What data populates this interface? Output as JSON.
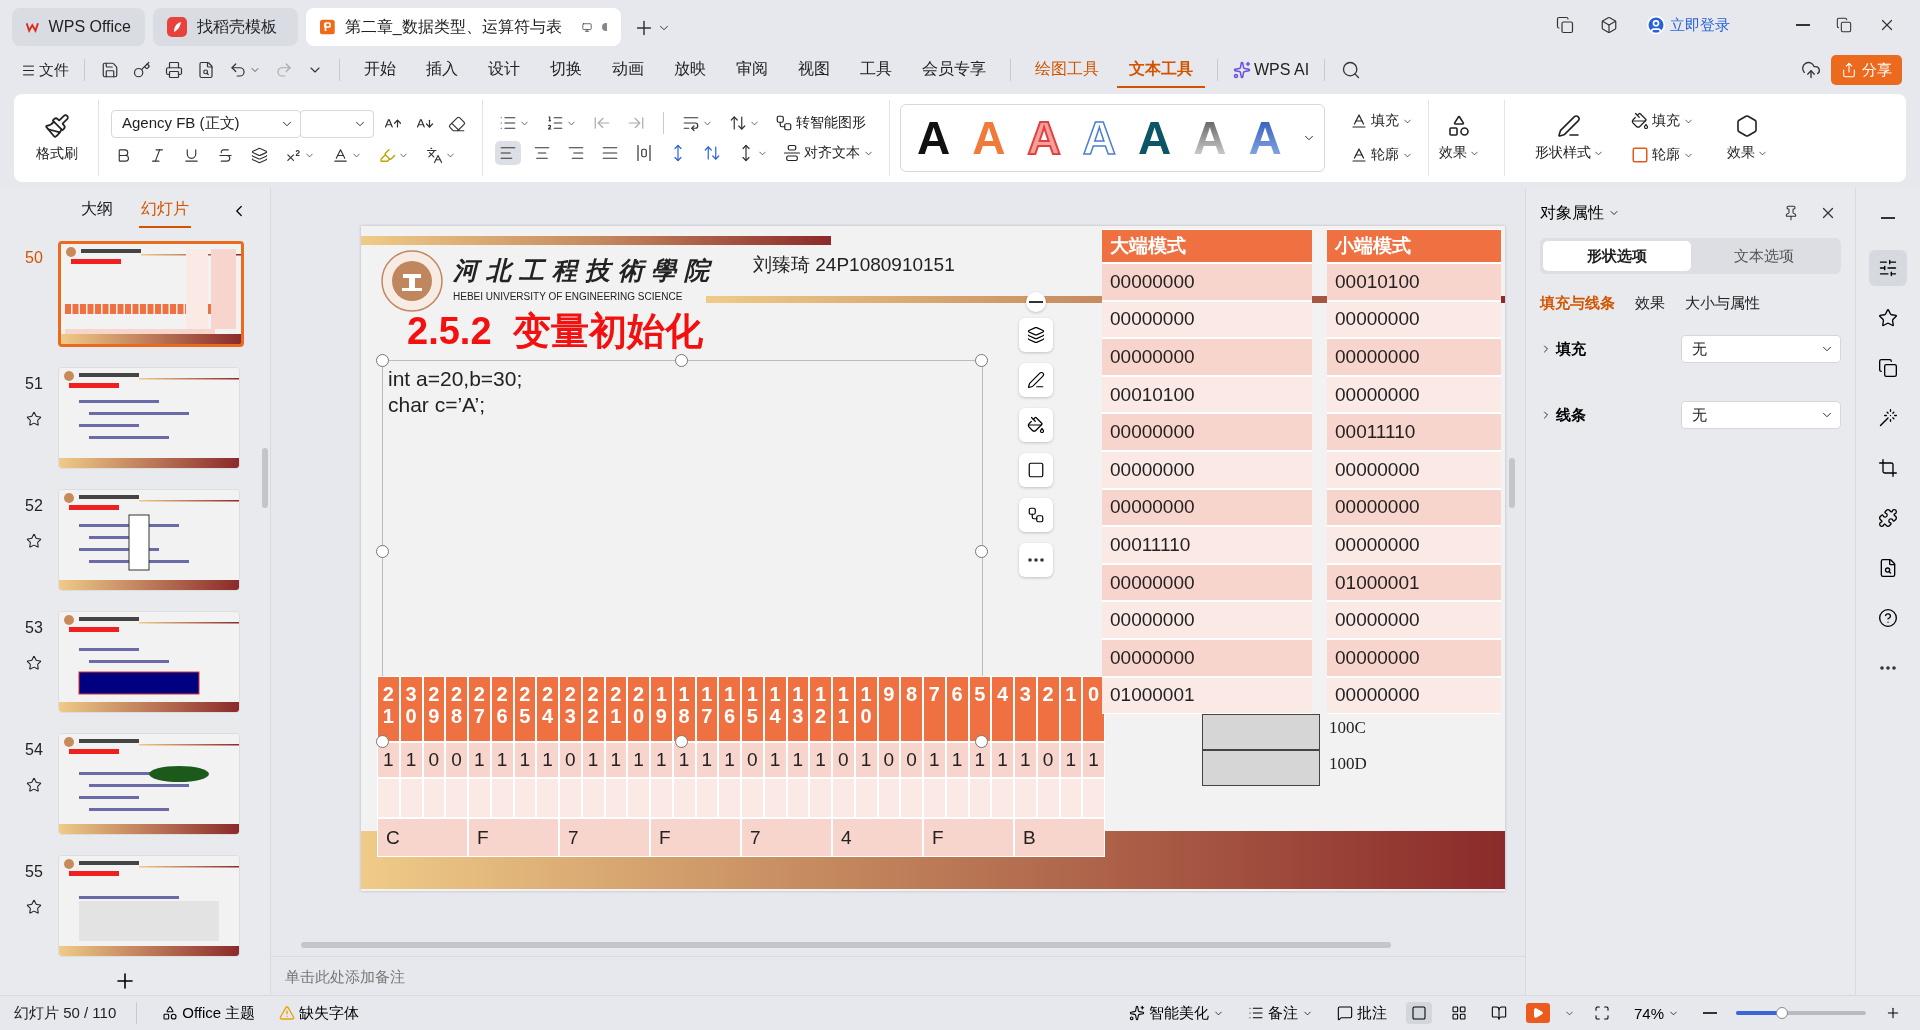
{
  "tabs": [
    {
      "label": "WPS Office",
      "kind": "home",
      "selected": false
    },
    {
      "label": "找稻壳模板",
      "kind": "template",
      "selected": false
    },
    {
      "label": "第二章_数据类型、运算符与表",
      "kind": "document",
      "selected": true
    }
  ],
  "account": {
    "login": "立即登录"
  },
  "menu": {
    "file": "文件",
    "items": [
      {
        "label": "开始",
        "kind": "plain",
        "selected": false
      },
      {
        "label": "插入",
        "kind": "plain",
        "selected": false
      },
      {
        "label": "设计",
        "kind": "plain",
        "selected": false
      },
      {
        "label": "切换",
        "kind": "plain",
        "selected": false
      },
      {
        "label": "动画",
        "kind": "plain",
        "selected": false
      },
      {
        "label": "放映",
        "kind": "plain",
        "selected": false
      },
      {
        "label": "审阅",
        "kind": "plain",
        "selected": false
      },
      {
        "label": "视图",
        "kind": "plain",
        "selected": false
      },
      {
        "label": "工具",
        "kind": "plain",
        "selected": false
      },
      {
        "label": "会员专享",
        "kind": "plain",
        "selected": false
      },
      {
        "label": "绘图工具",
        "kind": "context",
        "selected": false
      },
      {
        "label": "文本工具",
        "kind": "context",
        "selected": true
      }
    ],
    "ai": "WPS AI",
    "share": "分享"
  },
  "ribbon": {
    "format_painter": "格式刷",
    "font": "Agency FB (正文)",
    "smart_art": "转智能图形",
    "align_text": "对齐文本",
    "alignment": [
      {
        "kind": "left",
        "selected": true
      },
      {
        "kind": "center",
        "selected": false
      },
      {
        "kind": "right",
        "selected": false
      },
      {
        "kind": "justify",
        "selected": false
      },
      {
        "kind": "distributed",
        "selected": false
      }
    ],
    "text_styles": [
      {
        "label": "A",
        "kind": "black"
      },
      {
        "label": "A",
        "kind": "orange"
      },
      {
        "label": "A",
        "kind": "red-outline"
      },
      {
        "label": "A",
        "kind": "blue-outline"
      },
      {
        "label": "A",
        "kind": "teal"
      },
      {
        "label": "A",
        "kind": "grey"
      },
      {
        "label": "A",
        "kind": "blue"
      }
    ],
    "text_fill": "填充",
    "text_outline": "轮廓",
    "text_effect": "效果",
    "shape_style": "形状样式",
    "shape_fill": "填充",
    "shape_outline": "轮廓",
    "shape_effect": "效果"
  },
  "sidebar": {
    "tabs": [
      {
        "label": "大纲",
        "selected": false
      },
      {
        "label": "幻灯片",
        "selected": true
      }
    ],
    "slides": [
      {
        "number": "50",
        "selected": true
      },
      {
        "number": "51",
        "selected": false
      },
      {
        "number": "52",
        "selected": false
      },
      {
        "number": "53",
        "selected": false
      },
      {
        "number": "54",
        "selected": false
      },
      {
        "number": "55",
        "selected": false
      }
    ]
  },
  "slide": {
    "school": "河北工程技術學院",
    "school_en": "HEBEI UNIVERSITY OF ENGINEERING SCIENCE",
    "author": "刘臻琦 24P1080910151",
    "title": "2.5.2  变量初始化",
    "code": [
      "int a=20,b=30;",
      "char c=’A’;"
    ],
    "bit_positions": [
      "21",
      "30",
      "29",
      "28",
      "27",
      "26",
      "25",
      "24",
      "23",
      "22",
      "21",
      "20",
      "19",
      "18",
      "17",
      "16",
      "15",
      "14",
      "13",
      "12",
      "11",
      "10",
      "9",
      "8",
      "7",
      "6",
      "5",
      "4",
      "3",
      "2",
      "1",
      "0"
    ],
    "bits": [
      "1",
      "1",
      "0",
      "0",
      "1",
      "1",
      "1",
      "1",
      "0",
      "1",
      "1",
      "1",
      "1",
      "1",
      "1",
      "1",
      "0",
      "1",
      "1",
      "1",
      "0",
      "1",
      "0",
      "0",
      "1",
      "1",
      "1",
      "1",
      "1",
      "0",
      "1",
      "1"
    ],
    "hex": [
      "C",
      "F",
      "7",
      "F",
      "7",
      "4",
      "F",
      "B"
    ],
    "big_endian": {
      "header": "大端模式",
      "rows": [
        "00000000",
        "00000000",
        "00000000",
        "00010100",
        "00000000",
        "00000000",
        "00000000",
        "00011110",
        "00000000",
        "00000000",
        "00000000",
        "01000001"
      ]
    },
    "little_endian": {
      "header": "小端模式",
      "rows": [
        "00010100",
        "00000000",
        "00000000",
        "00000000",
        "00011110",
        "00000000",
        "00000000",
        "00000000",
        "01000001",
        "00000000",
        "00000000",
        "00000000"
      ]
    },
    "addresses": [
      "100C",
      "100D"
    ]
  },
  "notes": {
    "placeholder": "单击此处添加备注"
  },
  "properties": {
    "title": "对象属性",
    "tabs": [
      {
        "label": "形状选项",
        "selected": true
      },
      {
        "label": "文本选项",
        "selected": false
      }
    ],
    "subtabs": [
      {
        "label": "填充与线条",
        "selected": true
      },
      {
        "label": "效果",
        "selected": false
      },
      {
        "label": "大小与属性",
        "selected": false
      }
    ],
    "rows": [
      {
        "label": "填充",
        "value": "无",
        "expanded": false
      },
      {
        "label": "线条",
        "value": "无",
        "expanded": false
      }
    ]
  },
  "side_tools": [
    {
      "selected": false
    },
    {
      "selected": true
    },
    {
      "selected": false
    },
    {
      "selected": false
    },
    {
      "selected": false
    },
    {
      "selected": false
    },
    {
      "selected": false
    },
    {
      "selected": false
    },
    {
      "selected": false
    },
    {
      "selected": false
    }
  ],
  "status_bar": {
    "slide_counter": "幻灯片 50 / 110",
    "theme": "Office 主题",
    "missing_font": "缺失字体",
    "beautify": "智能美化",
    "notes": "备注",
    "comments": "批注",
    "views": [
      {
        "kind": "normal",
        "selected": true
      },
      {
        "kind": "sorter",
        "selected": false
      },
      {
        "kind": "reading",
        "selected": false
      }
    ],
    "zoom": "74%",
    "zoom_slider": {
      "level": 0.35
    }
  }
}
